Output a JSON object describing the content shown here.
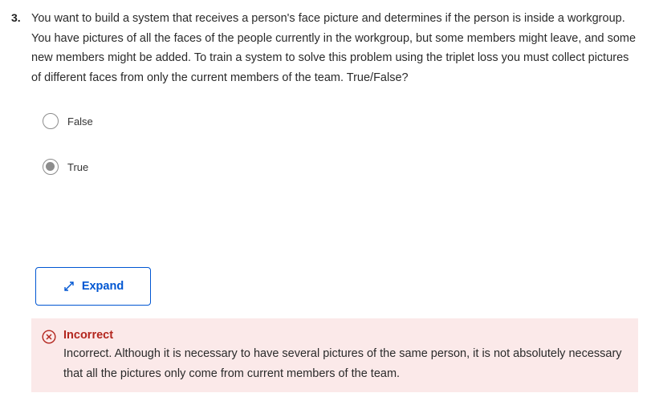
{
  "question": {
    "number": "3.",
    "text": "You want to build a system that receives a person's face picture and determines if the person is inside a workgroup. You have pictures of all the faces of the people currently in the workgroup, but some members might leave, and some new members might be added. To train a system to solve this problem using the triplet loss you must collect pictures of different faces from only the current members of the team. True/False?"
  },
  "options": [
    {
      "label": "False",
      "selected": false
    },
    {
      "label": "True",
      "selected": true
    }
  ],
  "expand": {
    "label": "Expand",
    "icon": "expand-arrows-icon"
  },
  "feedback": {
    "status": "Incorrect",
    "icon": "x-circle-icon",
    "text": "Incorrect. Although it is necessary to have several pictures of the same person, it is not absolutely necessary that all the pictures only come from current members of the team.",
    "color": "#b3261e",
    "background": "#fbe9e9"
  },
  "colors": {
    "accent": "#0056d2",
    "radio": "#8c8c8c"
  }
}
